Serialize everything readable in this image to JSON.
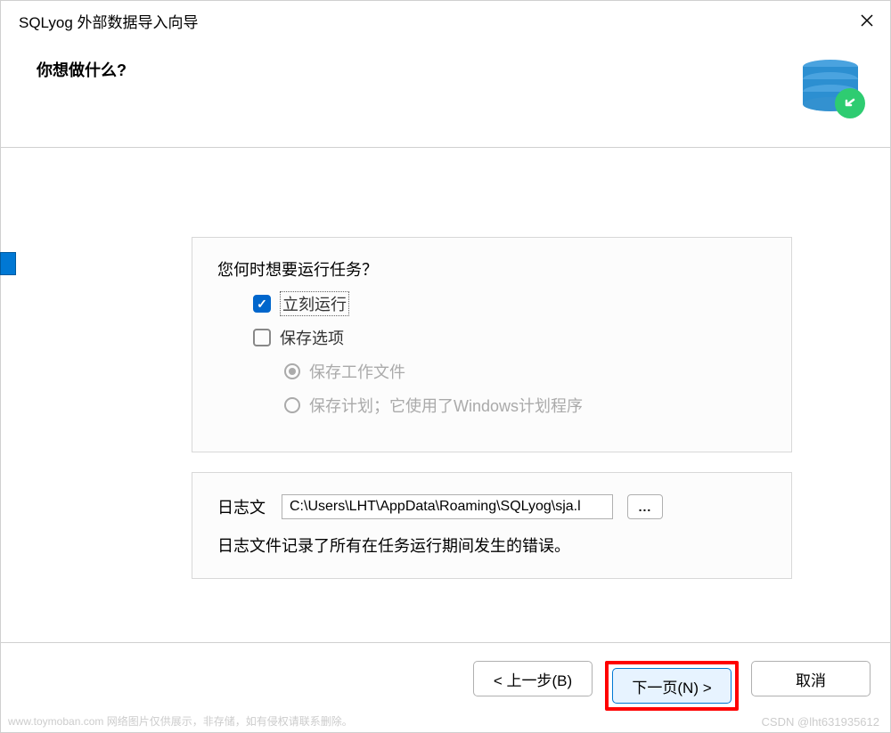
{
  "window": {
    "title": "SQLyog 外部数据导入向导"
  },
  "header": {
    "title": "你想做什么?"
  },
  "main": {
    "question": "您何时想要运行任务？",
    "options": {
      "run_now": {
        "label": "立刻运行",
        "checked": true
      },
      "save_options": {
        "label": "保存选项",
        "checked": false
      }
    },
    "sub_options": {
      "save_job": {
        "label": "保存工作文件",
        "selected": true
      },
      "save_schedule": {
        "label": "保存计划；它使用了Windows计划程序",
        "selected": false
      }
    },
    "log": {
      "label": "日志文",
      "path": "C:\\Users\\LHT\\AppData\\Roaming\\SQLyog\\sja.l",
      "browse": "...",
      "description": "日志文件记录了所有在任务运行期间发生的错误。"
    }
  },
  "footer": {
    "back": "< 上一步(B)",
    "next": "下一页(N) >",
    "cancel": "取消"
  },
  "watermarks": {
    "left": "www.toymoban.com  网络图片仅供展示，非存储，如有侵权请联系删除。",
    "right": "CSDN @lht631935612"
  }
}
